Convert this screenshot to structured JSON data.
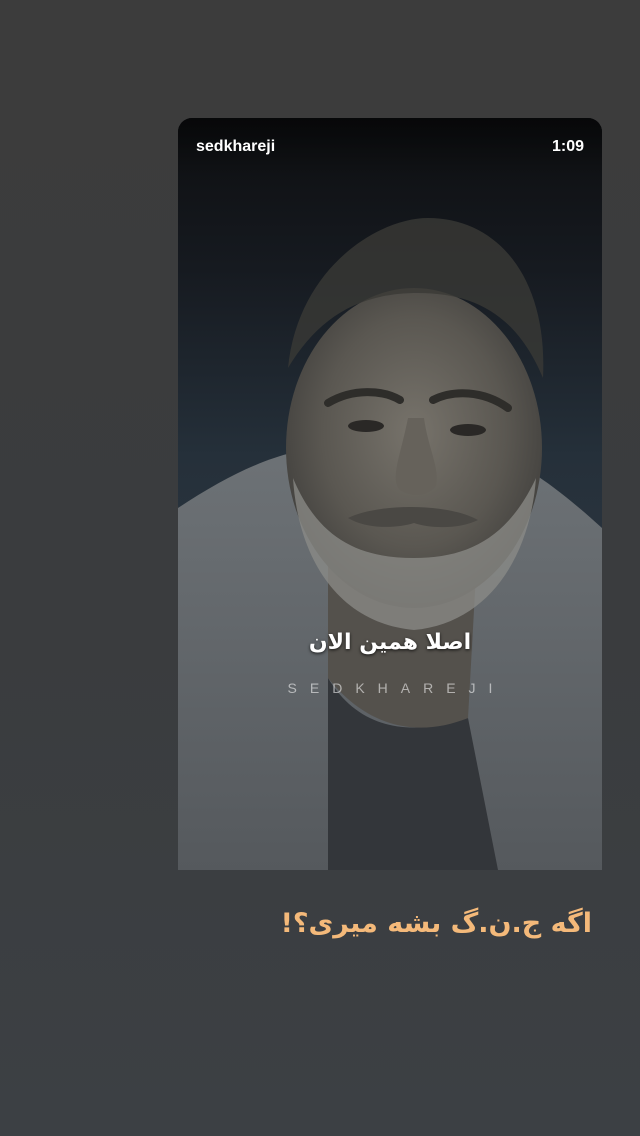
{
  "story": {
    "username": "sedkhareji",
    "timestamp": "1:09",
    "video": {
      "subtitle": "اصلا همین الان",
      "watermark": "SEDKHAREJI"
    },
    "caption": "اگه ج.ن.گ بشه میری؟!",
    "colors": {
      "caption": "#f4b97a",
      "background": "#3c3c3c"
    }
  }
}
